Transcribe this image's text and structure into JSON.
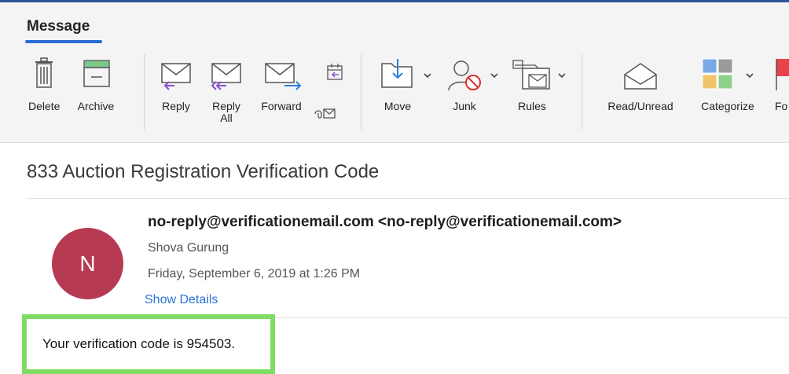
{
  "ribbon": {
    "tab_label": "Message",
    "accent_color": "#2b6cd4",
    "buttons": [
      {
        "label": "Delete",
        "icon": "trash-icon"
      },
      {
        "label": "Archive",
        "icon": "archive-icon"
      },
      {
        "label": "Reply",
        "icon": "reply-icon"
      },
      {
        "label": "Reply\nAll",
        "icon": "reply-all-icon"
      },
      {
        "label": "Forward",
        "icon": "forward-icon"
      },
      {
        "label": "Move",
        "icon": "move-icon"
      },
      {
        "label": "Junk",
        "icon": "junk-icon"
      },
      {
        "label": "Rules",
        "icon": "rules-icon"
      },
      {
        "label": "Read/Unread",
        "icon": "envelope-open-icon"
      },
      {
        "label": "Categorize",
        "icon": "categorize-icon"
      },
      {
        "label": "Fo",
        "icon": "follow-up-icon"
      }
    ]
  },
  "email": {
    "subject": "833 Auction Registration Verification Code",
    "avatar_letter": "N",
    "avatar_color": "#b73a53",
    "sender": "no-reply@verificationemail.com <no-reply@verificationemail.com>",
    "recipient": "Shova Gurung",
    "date": "Friday, September 6, 2019 at 1:26 PM",
    "show_details": "Show Details",
    "body": "Your verification code is 954503."
  },
  "annotation": {
    "highlight_color": "#7fdc62"
  }
}
